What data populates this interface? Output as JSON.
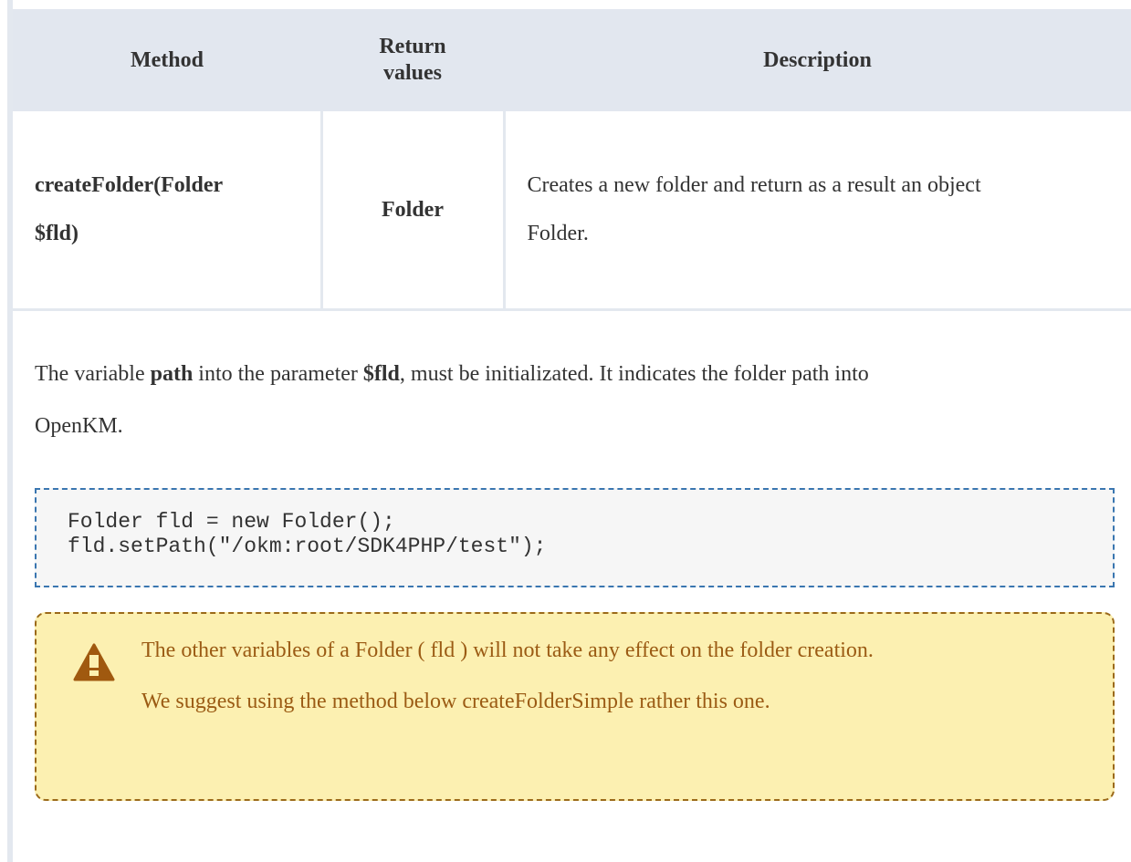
{
  "table": {
    "headers": {
      "method": "Method",
      "return_line1": "Return",
      "return_line2": "values",
      "description": "Description"
    },
    "row": {
      "method_line1": "createFolder(Folder",
      "method_line2": "$fld)",
      "return_value": "Folder",
      "description_line1": "Creates a new folder and return as a result an object",
      "description_line2": "Folder."
    }
  },
  "paragraph": {
    "t1": "The variable ",
    "b1": "path",
    "t2": " into the parameter ",
    "b2": "$fld",
    "t3": ", must be initializated. It indicates the folder path into",
    "t4": "OpenKM."
  },
  "code": {
    "line1": "Folder fld = new Folder();",
    "line2": "fld.setPath(\"/okm:root/SDK4PHP/test\");"
  },
  "warning": {
    "icon": "warning-icon",
    "text1": "The other variables of  a Folder ( fld ) will not take any effect on the folder creation.",
    "text2": "We suggest using the method below createFolderSimple rather this one.",
    "icon_color": "#9b5b14",
    "background": "#fcf0b1"
  }
}
